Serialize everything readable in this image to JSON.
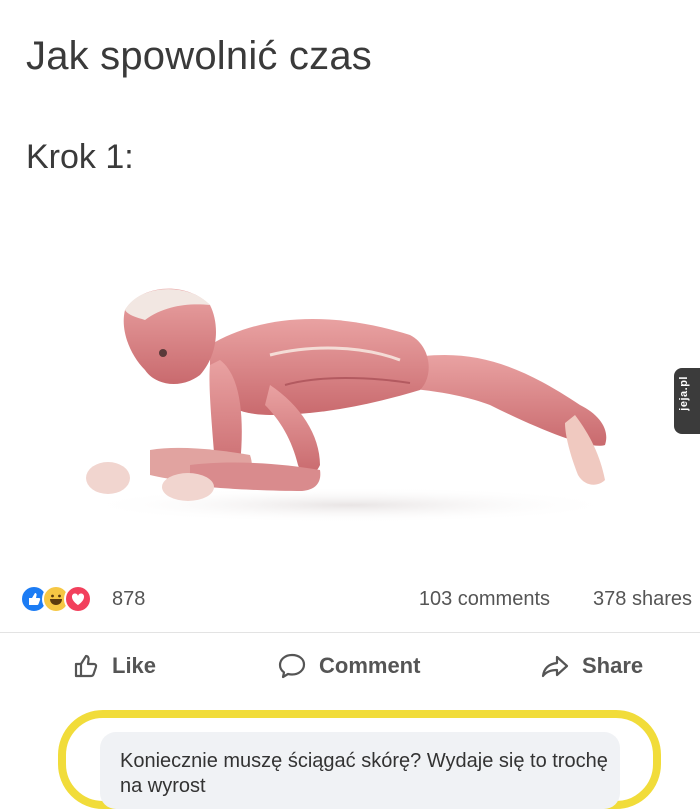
{
  "post": {
    "title": "Jak spowolnić czas",
    "step": "Krok 1:"
  },
  "watermark": "jeja.pl",
  "stats": {
    "reaction_icons": [
      "like-icon",
      "haha-icon",
      "love-icon"
    ],
    "reactions_count": "878",
    "comments": "103 comments",
    "shares": "378 shares"
  },
  "actions": {
    "like": "Like",
    "comment": "Comment",
    "share": "Share"
  },
  "comment": {
    "text": "Koniecznie muszę ściągać skórę? Wydaje się to trochę na wyrost"
  },
  "colors": {
    "like_blue": "#1c7cf4",
    "haha_yellow": "#f6c744",
    "love_red": "#f2405c",
    "highlight_yellow": "#f1dc3a"
  }
}
